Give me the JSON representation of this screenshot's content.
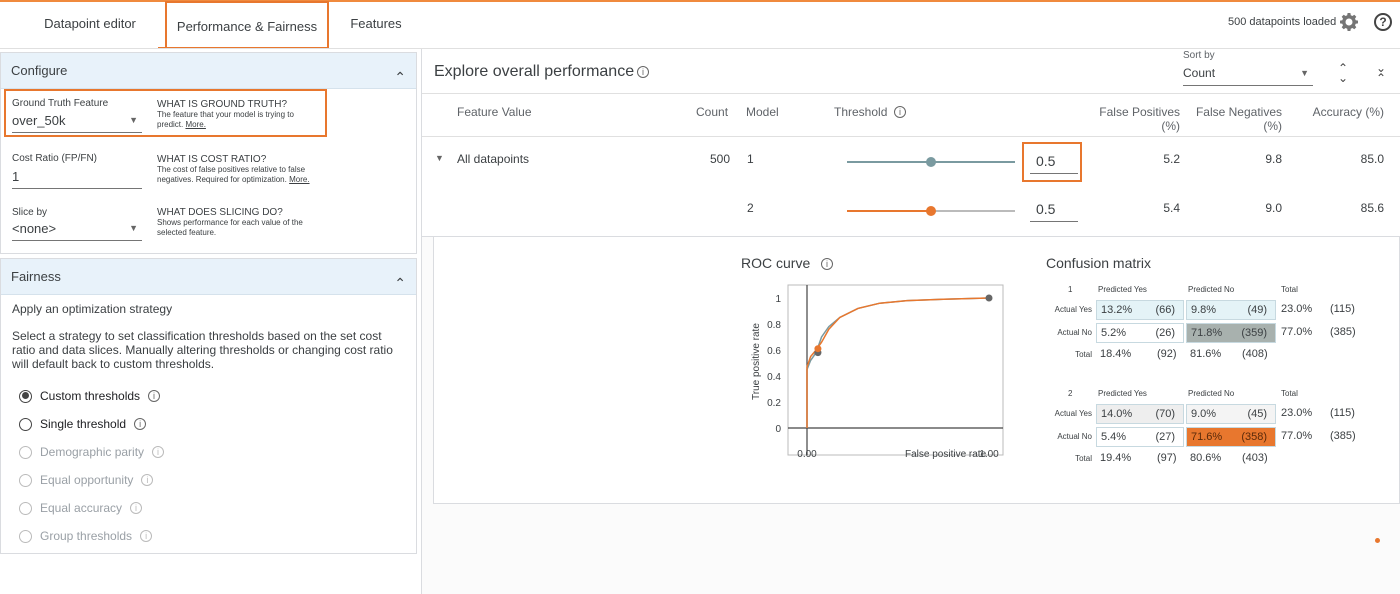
{
  "tabs": [
    {
      "label": "Datapoint editor"
    },
    {
      "label": "Performance & Fairness"
    },
    {
      "label": "Features"
    }
  ],
  "header": {
    "status": "500 datapoints loaded"
  },
  "configure": {
    "title": "Configure",
    "ground_truth": {
      "label": "Ground Truth Feature",
      "value": "over_50k",
      "help_title": "WHAT IS GROUND TRUTH?",
      "help_text": "The feature that your model is trying to predict.",
      "more": "More."
    },
    "cost_ratio": {
      "label": "Cost Ratio (FP/FN)",
      "value": "1",
      "help_title": "WHAT IS COST RATIO?",
      "help_text": "The cost of false positives relative to false negatives. Required for optimization.",
      "more": "More."
    },
    "slice_by": {
      "label": "Slice by",
      "value": "<none>",
      "help_title": "WHAT DOES SLICING DO?",
      "help_text": "Shows performance for each value of the selected feature."
    }
  },
  "fairness": {
    "title": "Fairness",
    "heading": "Apply an optimization strategy",
    "description": "Select a strategy to set classification thresholds based on the set cost ratio and data slices. Manually altering thresholds or changing cost ratio will default back to custom thresholds.",
    "options": [
      {
        "label": "Custom thresholds",
        "selected": true,
        "enabled": true
      },
      {
        "label": "Single threshold",
        "selected": false,
        "enabled": true
      },
      {
        "label": "Demographic parity",
        "selected": false,
        "enabled": false
      },
      {
        "label": "Equal opportunity",
        "selected": false,
        "enabled": false
      },
      {
        "label": "Equal accuracy",
        "selected": false,
        "enabled": false
      },
      {
        "label": "Group thresholds",
        "selected": false,
        "enabled": false
      }
    ]
  },
  "performance": {
    "title": "Explore overall performance",
    "sort_label": "Sort by",
    "sort_value": "Count",
    "columns": [
      "Feature Value",
      "Count",
      "Model",
      "Threshold",
      "False Positives (%)",
      "False Negatives (%)",
      "Accuracy (%)"
    ],
    "group": {
      "name": "All datapoints",
      "count": "500"
    },
    "rows": [
      {
        "model": "1",
        "threshold": "0.5",
        "threshold_level": 0.5,
        "fp": "5.2",
        "fn": "9.8",
        "acc": "85.0"
      },
      {
        "model": "2",
        "threshold": "0.5",
        "threshold_level": 0.5,
        "fp": "5.4",
        "fn": "9.0",
        "acc": "85.6"
      }
    ]
  },
  "roc": {
    "title": "ROC curve",
    "xlabel": "False positive rate",
    "ylabel": "True positive rate",
    "xticks": [
      "0.00",
      "1.00"
    ],
    "yticks": [
      "1",
      "0.8",
      "0.6",
      "0.4",
      "0.2",
      "0"
    ]
  },
  "chart_data": {
    "type": "line",
    "title": "ROC curve",
    "xlabel": "False positive rate",
    "ylabel": "True positive rate",
    "xlim": [
      0,
      1
    ],
    "ylim": [
      0,
      1
    ],
    "series": [
      {
        "name": "1",
        "color": "#7a9aa0",
        "x": [
          0,
          0.0,
          0.02,
          0.04,
          0.06,
          0.08,
          0.12,
          0.18,
          0.28,
          0.4,
          0.55,
          0.75,
          1.0
        ],
        "y": [
          0,
          0.45,
          0.52,
          0.56,
          0.62,
          0.7,
          0.78,
          0.85,
          0.92,
          0.96,
          0.98,
          0.99,
          1.0
        ]
      },
      {
        "name": "2",
        "color": "#e8772e",
        "x": [
          0,
          0.0,
          0.02,
          0.05,
          0.08,
          0.12,
          0.18,
          0.28,
          0.4,
          0.55,
          0.75,
          1.0
        ],
        "y": [
          0,
          0.47,
          0.55,
          0.6,
          0.66,
          0.76,
          0.85,
          0.92,
          0.96,
          0.98,
          0.99,
          1.0
        ]
      }
    ],
    "points": [
      {
        "series": "1",
        "x": 0.06,
        "y": 0.58,
        "color": "#666"
      },
      {
        "series": "2",
        "x": 0.06,
        "y": 0.61,
        "color": "#e8772e"
      },
      {
        "series": "1",
        "x": 1.0,
        "y": 1.0,
        "color": "#666"
      }
    ]
  },
  "confusion": {
    "title": "Confusion matrix",
    "models": [
      {
        "id": "1",
        "pred_yes": "Predicted Yes",
        "pred_no": "Predicted No",
        "total": "Total",
        "rows": [
          {
            "label": "Actual Yes",
            "c1p": "13.2%",
            "c1n": "(66)",
            "c2p": "9.8%",
            "c2n": "(49)",
            "tp": "23.0%",
            "tn": "(115)"
          },
          {
            "label": "Actual No",
            "c1p": "5.2%",
            "c1n": "(26)",
            "c2p": "71.8%",
            "c2n": "(359)",
            "tp": "77.0%",
            "tn": "(385)"
          }
        ],
        "totals": {
          "label": "Total",
          "c1p": "18.4%",
          "c1n": "(92)",
          "c2p": "81.6%",
          "c2n": "(408)"
        }
      },
      {
        "id": "2",
        "pred_yes": "Predicted Yes",
        "pred_no": "Predicted No",
        "total": "Total",
        "rows": [
          {
            "label": "Actual Yes",
            "c1p": "14.0%",
            "c1n": "(70)",
            "c2p": "9.0%",
            "c2n": "(45)",
            "tp": "23.0%",
            "tn": "(115)"
          },
          {
            "label": "Actual No",
            "c1p": "5.4%",
            "c1n": "(27)",
            "c2p": "71.6%",
            "c2n": "(358)",
            "tp": "77.0%",
            "tn": "(385)"
          }
        ],
        "totals": {
          "label": "Total",
          "c1p": "19.4%",
          "c1n": "(97)",
          "c2p": "80.6%",
          "c2n": "(403)"
        }
      }
    ]
  }
}
